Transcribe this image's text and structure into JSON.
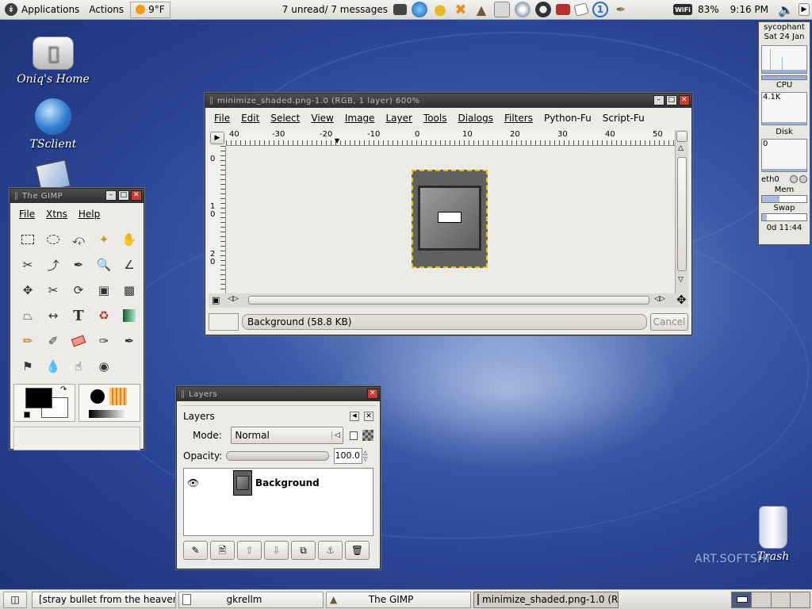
{
  "top_panel": {
    "applications": "Applications",
    "actions": "Actions",
    "weather": "9°F",
    "mail_status": "7 unread/ 7 messages",
    "wifi_label": "WiFi",
    "battery": "83%",
    "clock": "9:16 PM"
  },
  "desktop": {
    "icons": [
      {
        "label": "Oniq's Home"
      },
      {
        "label": "TSclient"
      }
    ],
    "trash_label": "Trash",
    "watermark": "ART.SOFTSHI"
  },
  "gimp_toolbox": {
    "title": "The GIMP",
    "menu": [
      "File",
      "Xtns",
      "Help"
    ]
  },
  "image_window": {
    "title": "minimize_shaded.png-1.0 (RGB, 1 layer) 600%",
    "menu": [
      "File",
      "Edit",
      "Select",
      "View",
      "Image",
      "Layer",
      "Tools",
      "Dialogs",
      "Filters",
      "Python-Fu",
      "Script-Fu"
    ],
    "h_ruler_ticks": [
      "40",
      "-30",
      "-20",
      "-10",
      "0",
      "10",
      "20",
      "30",
      "40",
      "50"
    ],
    "v_ruler_ticks": [
      "0",
      "1\n0",
      "2\n0"
    ],
    "status": "Background (58.8 KB)",
    "cancel_label": "Cancel"
  },
  "layers_window": {
    "title": "Layers",
    "header": "Layers",
    "mode_label": "Mode:",
    "mode_value": "Normal",
    "opacity_label": "Opacity:",
    "opacity_value": "100.0",
    "opacity_fraction": 1.0,
    "layer_name": "Background"
  },
  "gkrellm": {
    "host": "sycophant",
    "date": "Sat 24 Jan",
    "cpu_label": "CPU",
    "cpu_value": "4.1K",
    "disk_label": "Disk",
    "disk_value": "0",
    "net_label": "eth0",
    "mem_label": "Mem",
    "swap_label": "Swap",
    "uptime": "0d 11:44"
  },
  "taskbar": {
    "tasks": [
      {
        "label": "[stray bullet from the heaven"
      },
      {
        "label": "gkrellm"
      },
      {
        "label": "The GIMP"
      },
      {
        "label": "minimize_shaded.png-1.0 (R"
      }
    ]
  }
}
